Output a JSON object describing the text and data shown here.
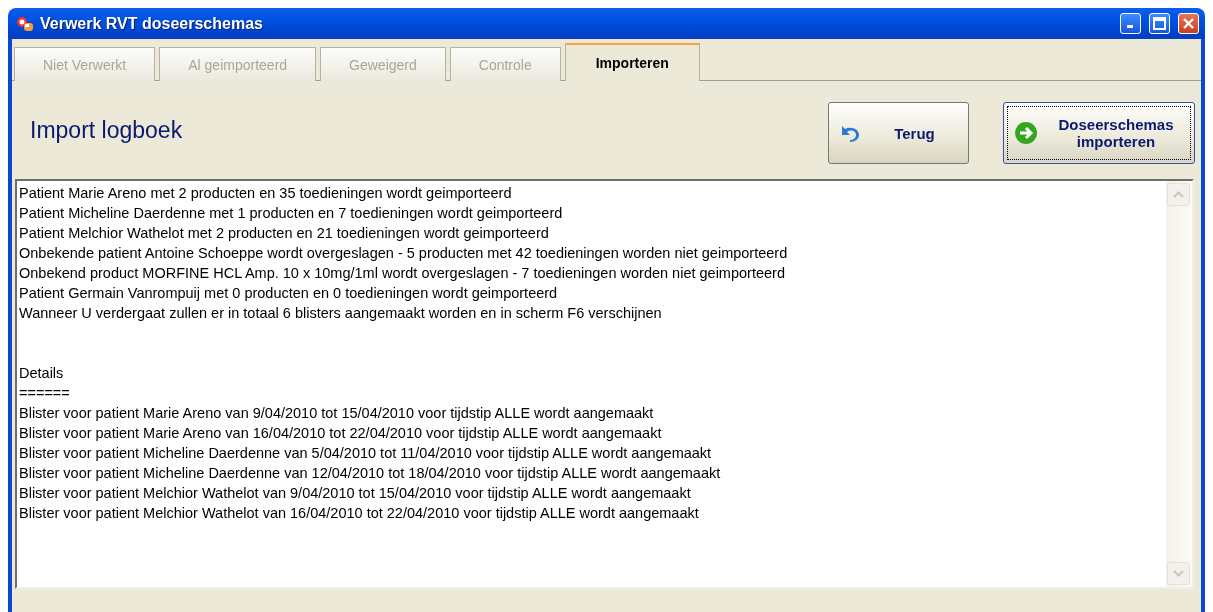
{
  "window": {
    "title": "Verwerk RVT doseerschemas"
  },
  "tabs": [
    {
      "label": "Niet Verwerkt",
      "selected": false,
      "disabled": true
    },
    {
      "label": "Al geimporteerd",
      "selected": false,
      "disabled": true
    },
    {
      "label": "Geweigerd",
      "selected": false,
      "disabled": true
    },
    {
      "label": "Controle",
      "selected": false,
      "disabled": true
    },
    {
      "label": "Importeren",
      "selected": true,
      "disabled": false
    }
  ],
  "heading": "Import logboek",
  "buttons": [
    {
      "kind": "back",
      "label": "Terug",
      "focused": false
    },
    {
      "kind": "import",
      "label": "Doseerschemas importeren",
      "focused": true
    }
  ],
  "log": {
    "summary_lines": [
      "Patient Marie Areno met 2 producten en 35 toedieningen wordt geimporteerd",
      "Patient Micheline Daerdenne met 1 producten en 7 toedieningen wordt geimporteerd",
      "Patient Melchior Wathelot met 2 producten en 21 toedieningen wordt geimporteerd",
      "Onbekende patient Antoine Schoeppe wordt overgeslagen - 5 producten met 42 toedieningen worden niet geimporteerd",
      "Onbekend product MORFINE HCL Amp. 10 x 10mg/1ml wordt overgeslagen - 7 toedieningen worden niet geimporteerd",
      "Patient Germain Vanrompuij met 0 producten en 0 toedieningen wordt geimporteerd",
      "Wanneer U verdergaat zullen er in totaal 6 blisters aangemaakt worden en in scherm F6 verschijnen"
    ],
    "details_heading": "Details",
    "details_rule": "======",
    "detail_lines": [
      "Blister voor patient Marie Areno van 9/04/2010 tot 15/04/2010 voor tijdstip ALLE wordt aangemaakt",
      "Blister voor patient Marie Areno van 16/04/2010 tot 22/04/2010 voor tijdstip ALLE wordt aangemaakt",
      "Blister voor patient Micheline Daerdenne van 5/04/2010 tot 11/04/2010 voor tijdstip ALLE wordt aangemaakt",
      "Blister voor patient Micheline Daerdenne van 12/04/2010 tot 18/04/2010 voor tijdstip ALLE wordt aangemaakt",
      "Blister voor patient Melchior Wathelot van 9/04/2010 tot 15/04/2010 voor tijdstip ALLE wordt aangemaakt",
      "Blister voor patient Melchior Wathelot van 16/04/2010 tot 22/04/2010 voor tijdstip ALLE wordt aangemaakt"
    ]
  }
}
